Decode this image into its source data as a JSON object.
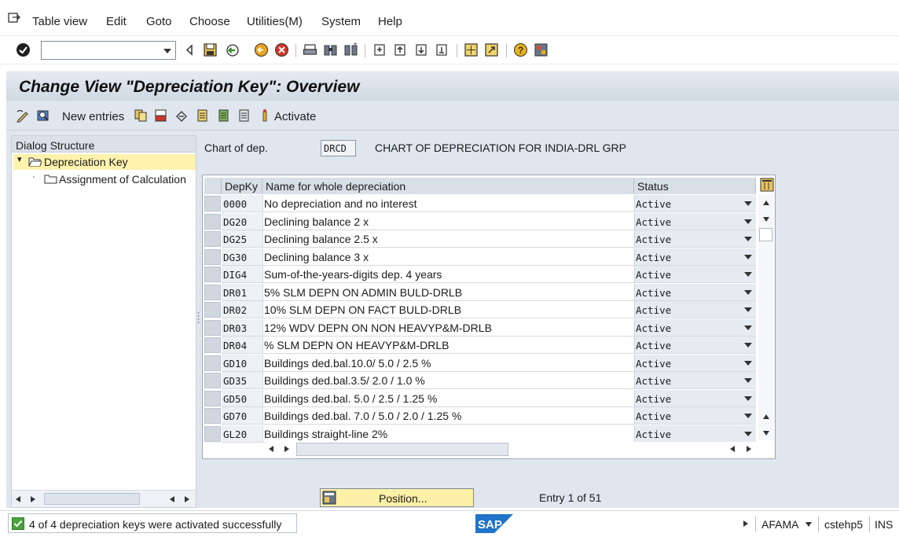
{
  "menu": {
    "items": [
      {
        "label": "Table view",
        "name": "menu-table-view"
      },
      {
        "label": "Edit",
        "name": "menu-edit"
      },
      {
        "label": "Goto",
        "name": "menu-goto"
      },
      {
        "label": "Choose",
        "name": "menu-choose"
      },
      {
        "label": "Utilities(M)",
        "name": "menu-utilities"
      },
      {
        "label": "System",
        "name": "menu-system"
      },
      {
        "label": "Help",
        "name": "menu-help"
      }
    ]
  },
  "toolbar": {
    "command_field_value": ""
  },
  "title": "Change View \"Depreciation Key\": Overview",
  "app_toolbar": {
    "new_entries_label": "New entries",
    "activate_label": "Activate"
  },
  "dialog_structure": {
    "heading": "Dialog Structure",
    "nodes": [
      {
        "label": "Depreciation Key"
      },
      {
        "label": "Assignment of Calculation"
      }
    ]
  },
  "chart_of_dep": {
    "label": "Chart of dep.",
    "value": "DRCD",
    "description": "CHART OF DEPRECIATION FOR INDIA-DRL GRP"
  },
  "table": {
    "columns": [
      "DepKy",
      "Name for whole depreciation",
      "Status"
    ],
    "rows": [
      {
        "key": "0000",
        "name": "No depreciation and no interest",
        "status": "Active"
      },
      {
        "key": "DG20",
        "name": "Declining balance 2 x",
        "status": "Active"
      },
      {
        "key": "DG25",
        "name": "Declining balance 2.5 x",
        "status": "Active"
      },
      {
        "key": "DG30",
        "name": "Declining balance 3 x",
        "status": "Active"
      },
      {
        "key": "DIG4",
        "name": "Sum-of-the-years-digits dep. 4 years",
        "status": "Active"
      },
      {
        "key": "DR01",
        "name": "5% SLM DEPN ON ADMIN BULD-DRLB",
        "status": "Active"
      },
      {
        "key": "DR02",
        "name": "10% SLM DEPN ON FACT BULD-DRLB",
        "status": "Active"
      },
      {
        "key": "DR03",
        "name": "12% WDV DEPN ON NON HEAVYP&M-DRLB",
        "status": "Active"
      },
      {
        "key": "DR04",
        "name": "% SLM DEPN ON HEAVYP&M-DRLB",
        "status": "Active"
      },
      {
        "key": "GD10",
        "name": "Buildings ded.bal.10.0/ 5.0 / 2.5 %",
        "status": "Active"
      },
      {
        "key": "GD35",
        "name": "Buildings ded.bal.3.5/ 2.0 / 1.0  %",
        "status": "Active"
      },
      {
        "key": "GD50",
        "name": "Buildings ded.bal. 5.0 / 2.5 / 1.25 %",
        "status": "Active"
      },
      {
        "key": "GD70",
        "name": "Buildings ded.bal. 7.0 / 5.0 / 2.0 / 1.25 %",
        "status": "Active"
      },
      {
        "key": "GL20",
        "name": "Buildings straight-line 2%",
        "status": "Active"
      }
    ]
  },
  "position_button": {
    "label": "Position..."
  },
  "entry_info": "Entry 1 of 51",
  "status_bar": {
    "message": "4 of 4 depreciation keys were activated successfully",
    "system": "AFAMA",
    "server": "cstehp5",
    "mode": "INS"
  },
  "colors": {
    "title_bar": "#d5dde6",
    "selected_node": "#fef2ac",
    "position_button": "#fdf0a7",
    "success": "#4ca33c"
  }
}
